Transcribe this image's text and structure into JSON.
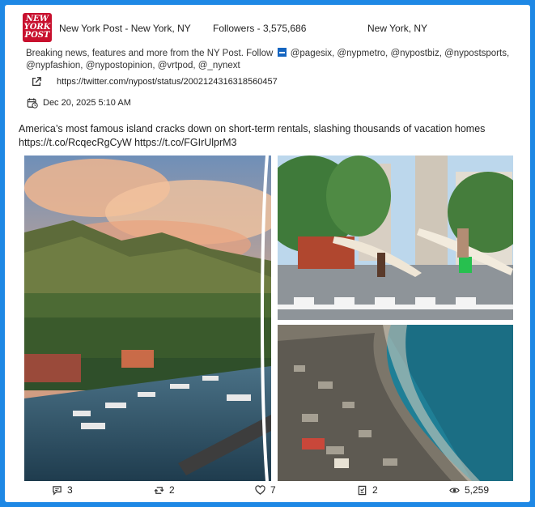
{
  "account": {
    "avatar_text_line1": "NEW",
    "avatar_text_line2": "YORK",
    "avatar_text_line3": "POST",
    "name_location": "New York Post - New York, NY",
    "followers": "Followers - 3,575,686",
    "location": "New York, NY",
    "bio_part1": "Breaking news, features and more from the NY Post. Follow",
    "bio_part2": "@pagesix, @nypmetro, @nypostbiz, @nypostsports, @nypfashion, @nypostopinion, @vrtpod, @_nynext"
  },
  "post": {
    "link": "https://twitter.com/nypost/status/2002124316318560457",
    "date": "Dec 20, 2025 5:10 AM",
    "text": "America’s most famous island cracks down on short-term rentals, slashing thousands of vacation homes https://t.co/RcqecRgCyW https://t.co/FGIrUlprM3"
  },
  "stats": {
    "replies": "3",
    "reposts": "2",
    "likes": "7",
    "bookmarks": "2",
    "views": "5,259"
  },
  "icons": {
    "link": "external-link-icon",
    "date": "calendar-clock-icon",
    "replies": "comment-icon",
    "reposts": "repost-icon",
    "likes": "heart-icon",
    "bookmarks": "bookmark-icon",
    "views": "eye-icon"
  },
  "colors": {
    "frame_border": "#1e88e5",
    "brand_red": "#c8102e",
    "flag_blue": "#1565c0"
  }
}
